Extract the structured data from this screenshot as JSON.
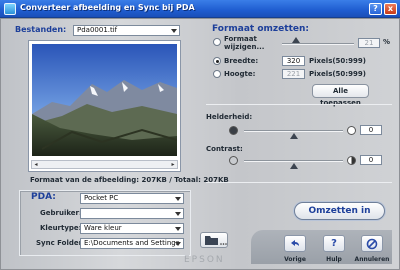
{
  "window": {
    "title": "Converteer afbeelding en Sync bij PDA",
    "help_glyph": "?",
    "close_glyph": "x"
  },
  "files": {
    "label": "Bestanden:",
    "selected": "Pda0001.tif"
  },
  "image_info": "Formaat van de afbeelding: 207KB / Totaal: 207KB",
  "convert": {
    "title": "Formaat omzetten:",
    "options": [
      {
        "label": "Formaat wijzigen...",
        "value": "21",
        "unit": "%",
        "selected": false
      },
      {
        "label": "Breedte:",
        "value": "320",
        "unit": "Pixels(50:999)",
        "selected": true
      },
      {
        "label": "Hoogte:",
        "value": "221",
        "unit": "Pixels(50:999)",
        "selected": false
      }
    ],
    "apply_all": "Alle toepassen",
    "size_slider_fraction": 0.2
  },
  "brightness": {
    "label": "Helderheid:",
    "value": "0",
    "slider_fraction": 0.5
  },
  "contrast": {
    "label": "Contrast:",
    "value": "0",
    "slider_fraction": 0.5
  },
  "pda": {
    "label": "PDA:",
    "device": "Pocket PC",
    "user_label": "Gebruiker:",
    "user": "",
    "color_label": "Kleurtype:",
    "color": "Ware kleur",
    "sync_label": "Sync Folder:",
    "sync_folder": "E:\\Documents and Settings"
  },
  "convert_button": "Omzetten in",
  "nav": {
    "back": "Vorige",
    "help": "Hulp",
    "cancel": "Annuleren"
  },
  "brand": "EPSON",
  "colors": {
    "title_blue": "#1d3f9a",
    "titlebar": "#2362d6"
  }
}
